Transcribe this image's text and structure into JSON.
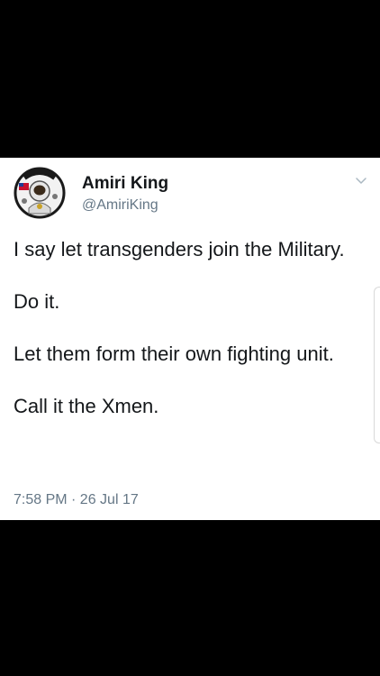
{
  "tweet": {
    "display_name": "Amiri King",
    "handle": "@AmiriKing",
    "avatar_badge_text": "AMIRI KING",
    "paragraphs": [
      "I say let transgenders join the Military.",
      "Do it.",
      "Let them form their own fighting unit.",
      "Call it the Xmen."
    ],
    "timestamp": "7:58 PM · 26 Jul 17"
  },
  "icons": {
    "avatar": "astronaut-patch-avatar",
    "menu": "chevron-down-icon"
  },
  "colors": {
    "background": "#000000",
    "card": "#ffffff",
    "text_primary": "#14171a",
    "text_secondary": "#657786"
  }
}
